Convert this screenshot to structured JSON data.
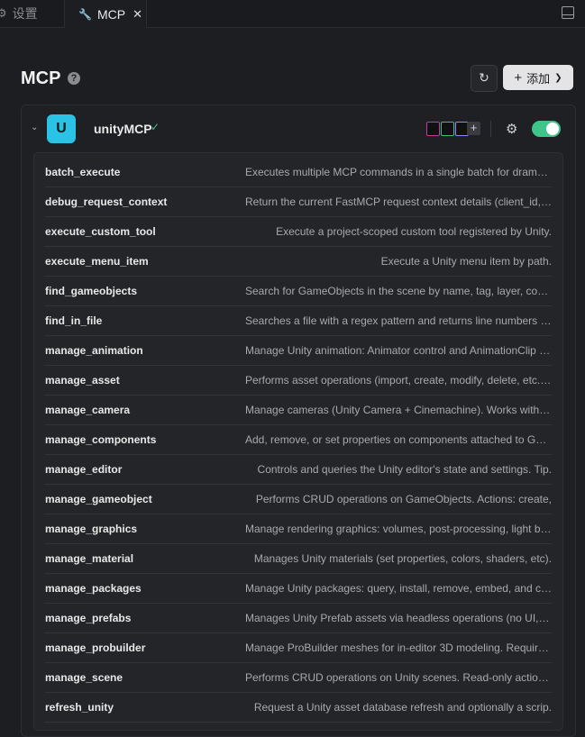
{
  "tabs": [
    {
      "label": "设置",
      "icon": "gear-icon"
    },
    {
      "label": "MCP",
      "icon": "wrench-icon",
      "close": "✕"
    }
  ],
  "page": {
    "title": "MCP",
    "help": "?",
    "add_label": "添加"
  },
  "server": {
    "avatar": "U",
    "name": "unityMCP",
    "enabled": true,
    "accent": "#2ac3e6",
    "status_color": "#3fc48a"
  },
  "tools": [
    {
      "name": "batch_execute",
      "desc": "Executes multiple MCP commands in a single batch for dramatic performance improvements"
    },
    {
      "name": "debug_request_context",
      "desc": "Return the current FastMCP request context details (client_id, session_id, and metadata)"
    },
    {
      "name": "execute_custom_tool",
      "desc": "Execute a project-scoped custom tool registered by Unity."
    },
    {
      "name": "execute_menu_item",
      "desc": "Execute a Unity menu item by path."
    },
    {
      "name": "find_gameobjects",
      "desc": "Search for GameObjects in the scene by name, tag, layer, component, path, or ID"
    },
    {
      "name": "find_in_file",
      "desc": "Searches a file with a regex pattern and returns line numbers and excerpts"
    },
    {
      "name": "manage_animation",
      "desc": "Manage Unity animation: Animator control and AnimationClip creation"
    },
    {
      "name": "manage_asset",
      "desc": "Performs asset operations (import, create, modify, delete, etc.) in Unity"
    },
    {
      "name": "manage_camera",
      "desc": "Manage cameras (Unity Camera + Cinemachine). Works without Cinemachine installed"
    },
    {
      "name": "manage_components",
      "desc": "Add, remove, or set properties on components attached to GameObjects"
    },
    {
      "name": "manage_editor",
      "desc": "Controls and queries the Unity editor's state and settings. Tip."
    },
    {
      "name": "manage_gameobject",
      "desc": "Performs CRUD operations on GameObjects. Actions: create,"
    },
    {
      "name": "manage_graphics",
      "desc": "Manage rendering graphics: volumes, post-processing, light baking"
    },
    {
      "name": "manage_material",
      "desc": "Manages Unity materials (set properties, colors, shaders, etc)."
    },
    {
      "name": "manage_packages",
      "desc": "Manage Unity packages: query, install, remove, embed, and configure"
    },
    {
      "name": "manage_prefabs",
      "desc": "Manages Unity Prefab assets via headless operations (no UI, no prefab stage)"
    },
    {
      "name": "manage_probuilder",
      "desc": "Manage ProBuilder meshes for in-editor 3D modeling. Requires ProBuilder"
    },
    {
      "name": "manage_scene",
      "desc": "Performs CRUD operations on Unity scenes. Read-only actions include get_hierarchy"
    },
    {
      "name": "refresh_unity",
      "desc": "Request a Unity asset database refresh and optionally a scrip."
    }
  ]
}
